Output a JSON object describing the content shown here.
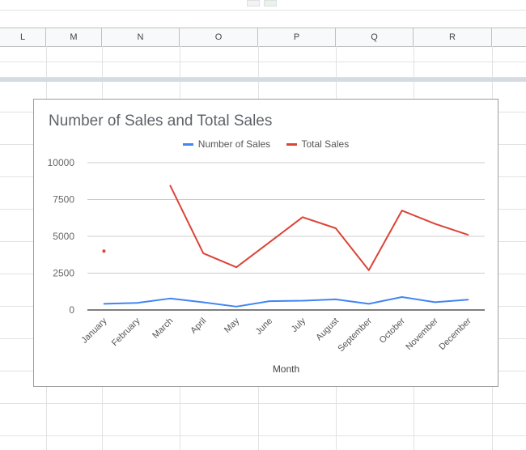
{
  "columns": [
    "L",
    "M",
    "N",
    "O",
    "P",
    "Q",
    "R"
  ],
  "chart": {
    "title": "Number of Sales and Total Sales",
    "xlabel": "Month",
    "colors": {
      "number_of_sales": "#4285f4",
      "total_sales": "#db4437"
    }
  },
  "chart_data": {
    "type": "line",
    "title": "Number of Sales and Total Sales",
    "xlabel": "Month",
    "ylabel": "",
    "categories": [
      "January",
      "February",
      "March",
      "April",
      "May",
      "June",
      "July",
      "August",
      "September",
      "October",
      "November",
      "December"
    ],
    "ylim": [
      0,
      10000
    ],
    "yticks": [
      0,
      2500,
      5000,
      7500,
      10000
    ],
    "legend_position": "top",
    "grid": true,
    "series": [
      {
        "name": "Number of Sales",
        "color": "#4285f4",
        "values": [
          420,
          480,
          780,
          520,
          230,
          600,
          630,
          720,
          420,
          880,
          530,
          700
        ]
      },
      {
        "name": "Total Sales",
        "color": "#db4437",
        "values": [
          4000,
          null,
          8450,
          3850,
          2900,
          4600,
          6300,
          5550,
          2700,
          6750,
          5850,
          5100
        ]
      }
    ]
  }
}
